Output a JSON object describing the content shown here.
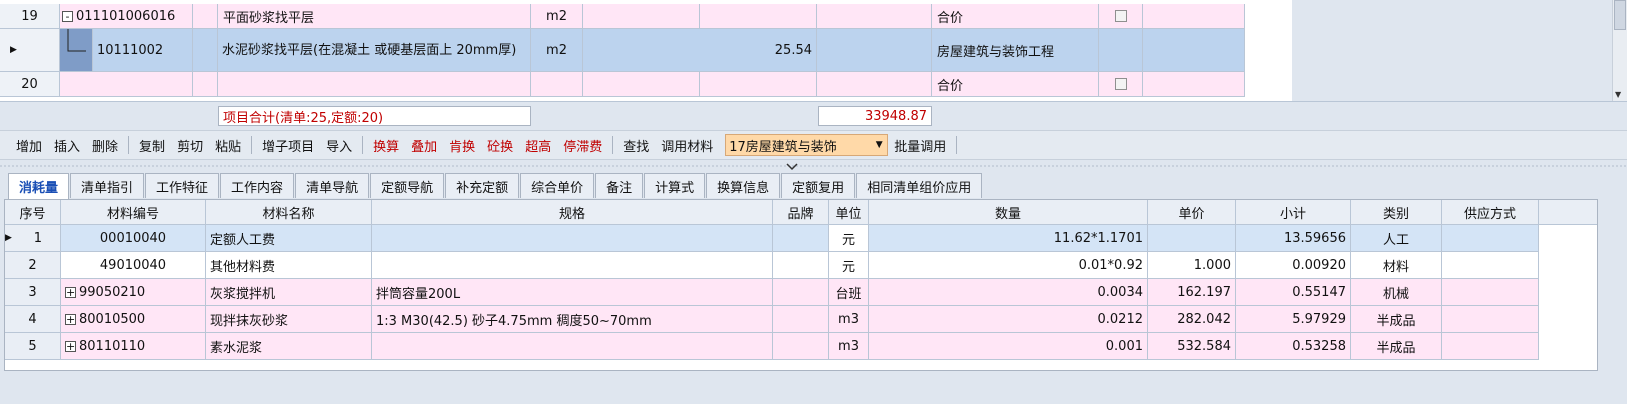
{
  "top_grid": {
    "rows": [
      {
        "seq": "19",
        "expander": "-",
        "code": "011101006016",
        "name": "平面砂浆找平层",
        "unit": "m2",
        "qty": "",
        "type": "合价",
        "checkbox": true
      },
      {
        "seq": "",
        "expander": "",
        "code": "10111002",
        "name": "水泥砂浆找平层(在混凝土 或硬基层面上 20mm厚)",
        "unit": "m2",
        "qty": "25.54",
        "type": "房屋建筑与装饰工程",
        "checkbox": false
      },
      {
        "seq": "20",
        "expander": "",
        "code": "",
        "name": "",
        "unit": "",
        "qty": "",
        "type": "合价",
        "checkbox": true
      }
    ]
  },
  "summary": {
    "count_label": "项目合计(清单:25,定额:20)",
    "total": "33948.87"
  },
  "toolbar": {
    "buttons": [
      {
        "label": "增加",
        "red": false
      },
      {
        "label": "插入",
        "red": false
      },
      {
        "label": "删除",
        "red": false
      },
      {
        "label": "复制",
        "red": false
      },
      {
        "label": "剪切",
        "red": false
      },
      {
        "label": "粘贴",
        "red": false
      },
      {
        "label": "增子项目",
        "red": false
      },
      {
        "label": "导入",
        "red": false
      },
      {
        "label": "换算",
        "red": true
      },
      {
        "label": "叠加",
        "red": true
      },
      {
        "label": "肯换",
        "red": true
      },
      {
        "label": "砼换",
        "red": true
      },
      {
        "label": "超高",
        "red": true
      },
      {
        "label": "停滞费",
        "red": true
      },
      {
        "label": "查找",
        "red": false
      },
      {
        "label": "调用材料",
        "red": false
      }
    ],
    "combo_value": "17房屋建筑与装饰",
    "batch_label": "批量调用"
  },
  "tabs": [
    "消耗量",
    "清单指引",
    "工作特征",
    "工作内容",
    "清单导航",
    "定额导航",
    "补充定额",
    "综合单价",
    "备注",
    "计算式",
    "换算信息",
    "定额复用",
    "相同清单组价应用"
  ],
  "bottom_grid": {
    "columns": [
      "序号",
      "材料编号",
      "材料名称",
      "规格",
      "品牌",
      "单位",
      "数量",
      "单价",
      "小计",
      "类别",
      "供应方式"
    ],
    "rows": [
      {
        "seq": "1",
        "expander": "",
        "code": "00010040",
        "name": "定额人工费",
        "spec": "",
        "brand": "",
        "unit": "元",
        "qty": "11.62*1.1701",
        "price": "",
        "subtotal": "13.59656",
        "category": "人工",
        "supply": ""
      },
      {
        "seq": "2",
        "expander": "",
        "code": "49010040",
        "name": "其他材料费",
        "spec": "",
        "brand": "",
        "unit": "元",
        "qty": "0.01*0.92",
        "price": "1.000",
        "subtotal": "0.00920",
        "category": "材料",
        "supply": ""
      },
      {
        "seq": "3",
        "expander": "+",
        "code": "99050210",
        "name": "灰浆搅拌机",
        "spec": "拌筒容量200L",
        "brand": "",
        "unit": "台班",
        "qty": "0.0034",
        "price": "162.197",
        "subtotal": "0.55147",
        "category": "机械",
        "supply": ""
      },
      {
        "seq": "4",
        "expander": "+",
        "code": "80010500",
        "name": "现拌抹灰砂浆",
        "spec": "1:3 M30(42.5) 砂子4.75mm 稠度50~70mm",
        "brand": "",
        "unit": "m3",
        "qty": "0.0212",
        "price": "282.042",
        "subtotal": "5.97929",
        "category": "半成品",
        "supply": ""
      },
      {
        "seq": "5",
        "expander": "+",
        "code": "80110110",
        "name": "素水泥浆",
        "spec": "",
        "brand": "",
        "unit": "m3",
        "qty": "0.001",
        "price": "532.584",
        "subtotal": "0.53258",
        "category": "半成品",
        "supply": ""
      }
    ]
  }
}
